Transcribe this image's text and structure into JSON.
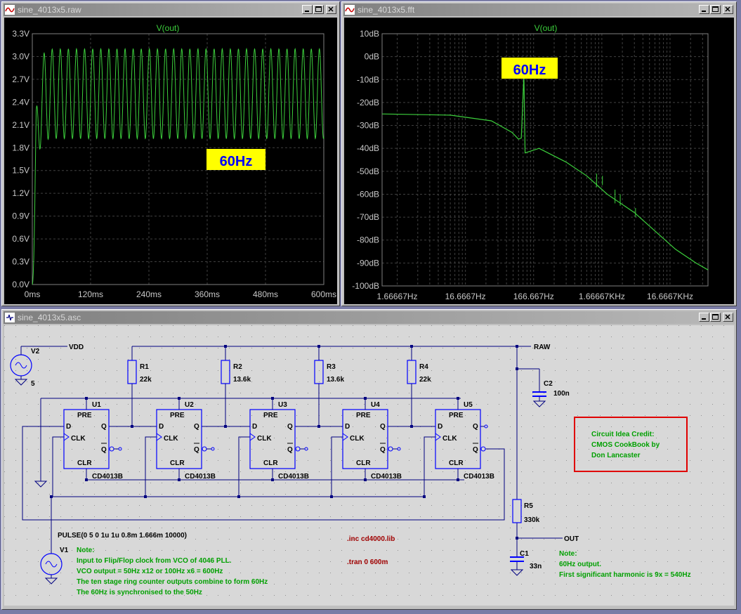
{
  "windows": {
    "raw": {
      "title": "sine_4013x5.raw"
    },
    "fft": {
      "title": "sine_4013x5.fft"
    },
    "schematic": {
      "title": "sine_4013x5.asc"
    }
  },
  "raw_plot": {
    "trace_label": "V(out)",
    "annotation": "60Hz",
    "y_ticks": [
      "3.3V",
      "3.0V",
      "2.7V",
      "2.4V",
      "2.1V",
      "1.8V",
      "1.5V",
      "1.2V",
      "0.9V",
      "0.6V",
      "0.3V",
      "0.0V"
    ],
    "x_ticks": [
      "0ms",
      "120ms",
      "240ms",
      "360ms",
      "480ms",
      "600ms"
    ]
  },
  "fft_plot": {
    "trace_label": "V(out)",
    "annotation": "60Hz",
    "y_ticks": [
      "10dB",
      "0dB",
      "-10dB",
      "-20dB",
      "-30dB",
      "-40dB",
      "-50dB",
      "-60dB",
      "-70dB",
      "-80dB",
      "-90dB",
      "-100dB"
    ],
    "x_ticks": [
      "1.66667Hz",
      "16.6667Hz",
      "166.667Hz",
      "1.66667KHz",
      "16.6667KHz"
    ]
  },
  "chart_data": [
    {
      "type": "line",
      "series": [
        {
          "name": "V(out)",
          "description_points": [
            [
              0,
              0
            ],
            [
              5,
              1.8
            ],
            [
              10,
              2.4
            ],
            [
              15,
              2.9
            ],
            [
              20,
              3.05
            ],
            [
              600,
              2.5
            ]
          ]
        }
      ],
      "ylabel": "",
      "xlabel": "",
      "ylim": [
        0,
        3.3
      ],
      "xlim": [
        0,
        600
      ],
      "oscillation": {
        "min_v": 1.92,
        "max_v": 3.1,
        "frequency_hz": 60
      }
    },
    {
      "type": "line",
      "xscale": "log",
      "series": [
        {
          "name": "V(out)",
          "points": [
            [
              1.0,
              -25
            ],
            [
              10,
              -25.5
            ],
            [
              40,
              -28
            ],
            [
              80,
              -33
            ],
            [
              100,
              -36
            ],
            [
              110,
              -35.5
            ],
            [
              120,
              -8
            ],
            [
              125,
              -42
            ],
            [
              200,
              -40
            ],
            [
              500,
              -46
            ],
            [
              1000,
              -52
            ],
            [
              2000,
              -60
            ],
            [
              5000,
              -68
            ],
            [
              10000,
              -76
            ],
            [
              20000,
              -84
            ],
            [
              40000,
              -90
            ],
            [
              60000,
              -93
            ]
          ]
        }
      ],
      "ylim": [
        -100,
        10
      ],
      "xlim": [
        1,
        60000
      ]
    }
  ],
  "schematic": {
    "v2": {
      "name": "V2",
      "value": "5"
    },
    "v1": {
      "name": "V1",
      "value": "PULSE(0 5 0 1u 1u 0.8m 1.666m 10000)"
    },
    "nets": {
      "vdd": "VDD",
      "raw": "RAW",
      "out": "OUT"
    },
    "resistors": [
      {
        "name": "R1",
        "value": "22k"
      },
      {
        "name": "R2",
        "value": "13.6k"
      },
      {
        "name": "R3",
        "value": "13.6k"
      },
      {
        "name": "R4",
        "value": "22k"
      },
      {
        "name": "R5",
        "value": "330k"
      }
    ],
    "caps": [
      {
        "name": "C2",
        "value": "100n"
      },
      {
        "name": "C1",
        "value": "33n"
      }
    ],
    "ffs": [
      {
        "name": "U1",
        "part": "CD4013B"
      },
      {
        "name": "U2",
        "part": "CD4013B"
      },
      {
        "name": "U3",
        "part": "CD4013B"
      },
      {
        "name": "U4",
        "part": "CD4013B"
      },
      {
        "name": "U5",
        "part": "CD4013B"
      }
    ],
    "pins": {
      "pre": "PRE",
      "clr": "CLR",
      "d": "D",
      "q": "Q",
      "qbar": "Q",
      "clk": "CLK"
    },
    "directives": {
      "inc": ".inc cd4000.lib",
      "tran": ".tran 0 600m"
    },
    "note_left": [
      "Note:",
      "Input to Flip/Flop clock from VCO of 4046 PLL.",
      "VCO output = 50Hz x12 or 100Hz x6 = 600Hz",
      "The ten stage ring counter outputs combine to form 60Hz",
      "The 60Hz is synchronised to the 50Hz"
    ],
    "note_right": [
      "Note:",
      "60Hz output.",
      "First significant harmonic is 9x = 540Hz"
    ],
    "credit": [
      "Circuit Idea Credit:",
      "CMOS CookBook by",
      "Don Lancaster"
    ]
  },
  "colors": {
    "trace": "#3ccf3c",
    "grid": "#404040",
    "axis_text": "#c8c8c8",
    "label_bg": "#ffff00",
    "label_text": "#0000ff",
    "schem_wire": "#000080",
    "schem_comp": "#0000ff",
    "note": "#00a000",
    "directive": "#a00000",
    "credit_box": "#e00000"
  }
}
